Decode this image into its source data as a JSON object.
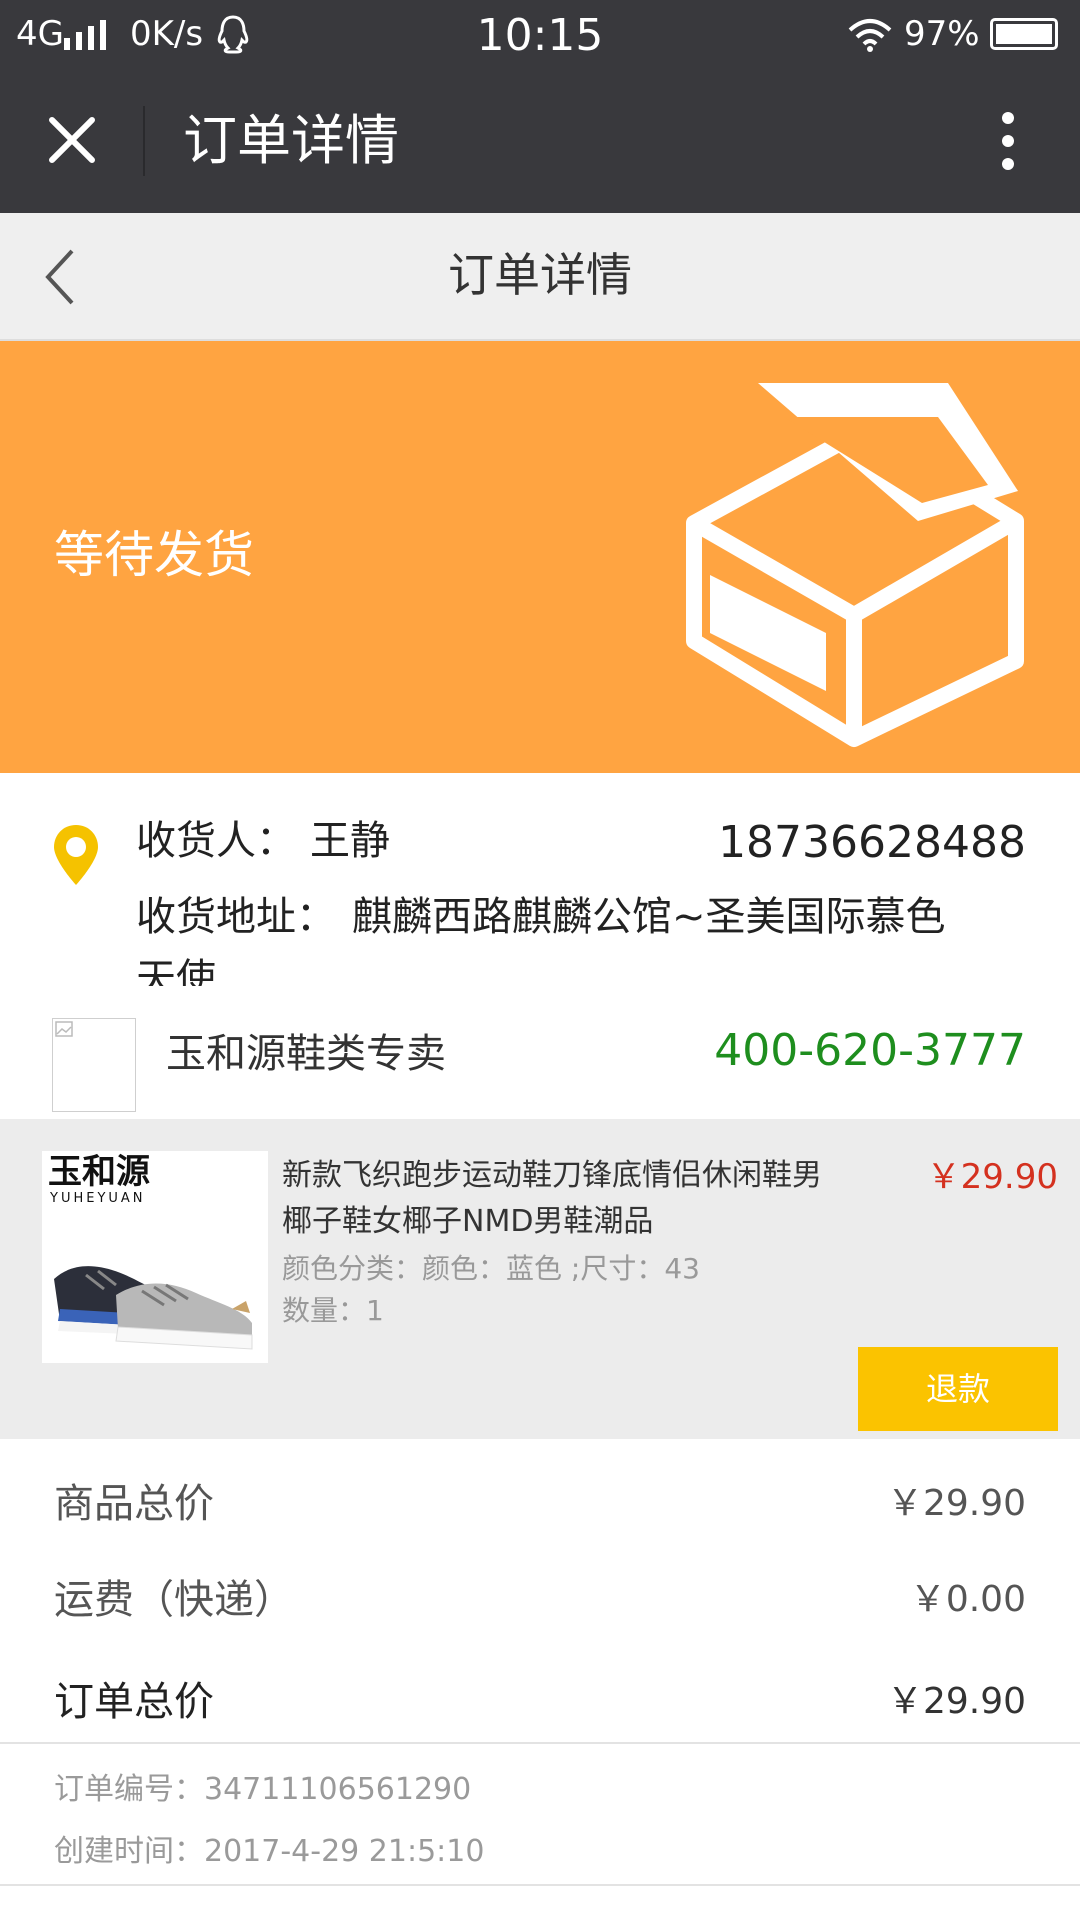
{
  "status_bar": {
    "network": "4G",
    "speed": "0K/s",
    "time": "10:15",
    "battery": "97%"
  },
  "wechat_header": {
    "title": "订单详情"
  },
  "nav": {
    "title": "订单详情"
  },
  "order_status": {
    "label": "等待发货",
    "banner_color": "#ffa441"
  },
  "address": {
    "recipient_label": "收货人：",
    "recipient_name": "王静",
    "phone": "18736628488",
    "address_label": "收货地址：",
    "address_line1": "麒麟西路麒麟公馆~圣美国际慕色",
    "address_line2": "天使"
  },
  "store": {
    "name": "玉和源鞋类专卖",
    "phone": "400-620-3777"
  },
  "product": {
    "brand_cn": "玉和源",
    "brand_en": "YUHEYUAN",
    "title_line1": "新款飞织跑步运动鞋刀锋底情侣休闲鞋男",
    "title_line2": "椰子鞋女椰子NMD男鞋潮品",
    "price": "￥29.90",
    "spec": "颜色分类：颜色：蓝色 ;尺寸：43",
    "quantity": "数量：1",
    "refund_label": "退款"
  },
  "totals": {
    "goods_label": "商品总价",
    "goods_value": "￥29.90",
    "shipping_label": "运费（快递）",
    "shipping_value": "￥0.00",
    "order_label": "订单总价",
    "order_value": "￥29.90"
  },
  "meta": {
    "order_no": "订单编号：34711106561290",
    "created": "创建时间：2017-4-29 21:5:10"
  },
  "colors": {
    "header_bg": "#39393d",
    "price_red": "#d4311f",
    "store_phone_green": "#1e8e1e",
    "refund_yellow": "#fbc300",
    "location_pin": "#f5c200"
  }
}
